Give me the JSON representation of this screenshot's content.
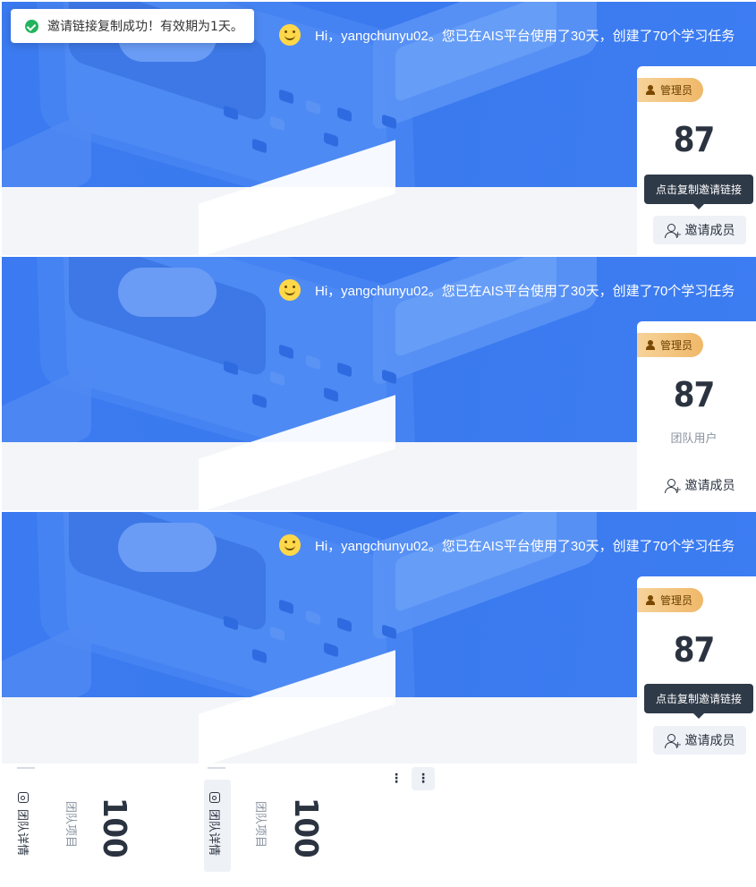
{
  "toast": {
    "message": "邀请链接复制成功！有效期为1天。",
    "icon": "check-circle-icon"
  },
  "greeting": "Hi，yangchunyu02。您已在AIS平台使用了30天，创建了70个学习任务",
  "panels": [
    {
      "badge": "管理员",
      "count": "87",
      "sublabel": "",
      "tooltip": "点击复制邀请链接",
      "invite": "邀请成员"
    },
    {
      "badge": "管理员",
      "count": "87",
      "sublabel": "团队用户",
      "tooltip": "",
      "invite": "邀请成员"
    },
    {
      "badge": "管理员",
      "count": "87",
      "sublabel": "",
      "tooltip": "点击复制邀请链接",
      "invite": "邀请成员"
    }
  ],
  "bottom": {
    "cards": [
      {
        "tab": "团队详情",
        "stat_label": "团队项目",
        "stat_value": "100"
      },
      {
        "tab": "团队详情",
        "stat_label": "团队项目",
        "stat_value": "100"
      }
    ],
    "more_icon": "⋮"
  },
  "colors": {
    "banner": "#3b7af0",
    "badge": "#f0b869",
    "tooltip": "#2f3a48",
    "success": "#22b35e"
  }
}
